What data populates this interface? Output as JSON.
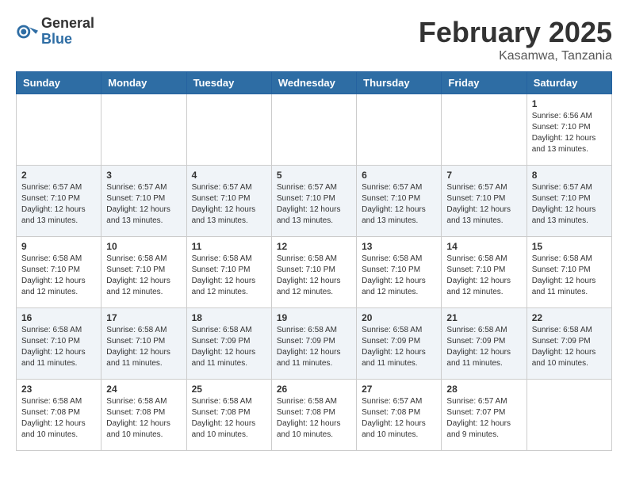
{
  "header": {
    "logo_general": "General",
    "logo_blue": "Blue",
    "month_year": "February 2025",
    "location": "Kasamwa, Tanzania"
  },
  "days_of_week": [
    "Sunday",
    "Monday",
    "Tuesday",
    "Wednesday",
    "Thursday",
    "Friday",
    "Saturday"
  ],
  "weeks": [
    [
      {
        "day": "",
        "info": ""
      },
      {
        "day": "",
        "info": ""
      },
      {
        "day": "",
        "info": ""
      },
      {
        "day": "",
        "info": ""
      },
      {
        "day": "",
        "info": ""
      },
      {
        "day": "",
        "info": ""
      },
      {
        "day": "1",
        "info": "Sunrise: 6:56 AM\nSunset: 7:10 PM\nDaylight: 12 hours\nand 13 minutes."
      }
    ],
    [
      {
        "day": "2",
        "info": "Sunrise: 6:57 AM\nSunset: 7:10 PM\nDaylight: 12 hours\nand 13 minutes."
      },
      {
        "day": "3",
        "info": "Sunrise: 6:57 AM\nSunset: 7:10 PM\nDaylight: 12 hours\nand 13 minutes."
      },
      {
        "day": "4",
        "info": "Sunrise: 6:57 AM\nSunset: 7:10 PM\nDaylight: 12 hours\nand 13 minutes."
      },
      {
        "day": "5",
        "info": "Sunrise: 6:57 AM\nSunset: 7:10 PM\nDaylight: 12 hours\nand 13 minutes."
      },
      {
        "day": "6",
        "info": "Sunrise: 6:57 AM\nSunset: 7:10 PM\nDaylight: 12 hours\nand 13 minutes."
      },
      {
        "day": "7",
        "info": "Sunrise: 6:57 AM\nSunset: 7:10 PM\nDaylight: 12 hours\nand 13 minutes."
      },
      {
        "day": "8",
        "info": "Sunrise: 6:57 AM\nSunset: 7:10 PM\nDaylight: 12 hours\nand 13 minutes."
      }
    ],
    [
      {
        "day": "9",
        "info": "Sunrise: 6:58 AM\nSunset: 7:10 PM\nDaylight: 12 hours\nand 12 minutes."
      },
      {
        "day": "10",
        "info": "Sunrise: 6:58 AM\nSunset: 7:10 PM\nDaylight: 12 hours\nand 12 minutes."
      },
      {
        "day": "11",
        "info": "Sunrise: 6:58 AM\nSunset: 7:10 PM\nDaylight: 12 hours\nand 12 minutes."
      },
      {
        "day": "12",
        "info": "Sunrise: 6:58 AM\nSunset: 7:10 PM\nDaylight: 12 hours\nand 12 minutes."
      },
      {
        "day": "13",
        "info": "Sunrise: 6:58 AM\nSunset: 7:10 PM\nDaylight: 12 hours\nand 12 minutes."
      },
      {
        "day": "14",
        "info": "Sunrise: 6:58 AM\nSunset: 7:10 PM\nDaylight: 12 hours\nand 12 minutes."
      },
      {
        "day": "15",
        "info": "Sunrise: 6:58 AM\nSunset: 7:10 PM\nDaylight: 12 hours\nand 11 minutes."
      }
    ],
    [
      {
        "day": "16",
        "info": "Sunrise: 6:58 AM\nSunset: 7:10 PM\nDaylight: 12 hours\nand 11 minutes."
      },
      {
        "day": "17",
        "info": "Sunrise: 6:58 AM\nSunset: 7:10 PM\nDaylight: 12 hours\nand 11 minutes."
      },
      {
        "day": "18",
        "info": "Sunrise: 6:58 AM\nSunset: 7:09 PM\nDaylight: 12 hours\nand 11 minutes."
      },
      {
        "day": "19",
        "info": "Sunrise: 6:58 AM\nSunset: 7:09 PM\nDaylight: 12 hours\nand 11 minutes."
      },
      {
        "day": "20",
        "info": "Sunrise: 6:58 AM\nSunset: 7:09 PM\nDaylight: 12 hours\nand 11 minutes."
      },
      {
        "day": "21",
        "info": "Sunrise: 6:58 AM\nSunset: 7:09 PM\nDaylight: 12 hours\nand 11 minutes."
      },
      {
        "day": "22",
        "info": "Sunrise: 6:58 AM\nSunset: 7:09 PM\nDaylight: 12 hours\nand 10 minutes."
      }
    ],
    [
      {
        "day": "23",
        "info": "Sunrise: 6:58 AM\nSunset: 7:08 PM\nDaylight: 12 hours\nand 10 minutes."
      },
      {
        "day": "24",
        "info": "Sunrise: 6:58 AM\nSunset: 7:08 PM\nDaylight: 12 hours\nand 10 minutes."
      },
      {
        "day": "25",
        "info": "Sunrise: 6:58 AM\nSunset: 7:08 PM\nDaylight: 12 hours\nand 10 minutes."
      },
      {
        "day": "26",
        "info": "Sunrise: 6:58 AM\nSunset: 7:08 PM\nDaylight: 12 hours\nand 10 minutes."
      },
      {
        "day": "27",
        "info": "Sunrise: 6:57 AM\nSunset: 7:08 PM\nDaylight: 12 hours\nand 10 minutes."
      },
      {
        "day": "28",
        "info": "Sunrise: 6:57 AM\nSunset: 7:07 PM\nDaylight: 12 hours\nand 9 minutes."
      },
      {
        "day": "",
        "info": ""
      }
    ]
  ]
}
